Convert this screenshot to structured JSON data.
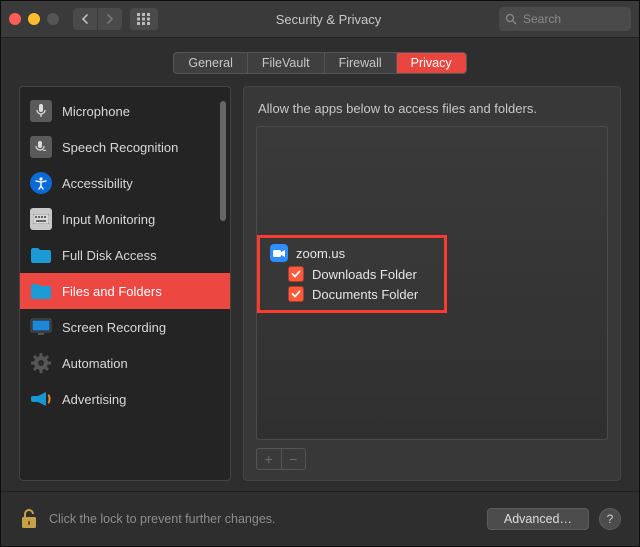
{
  "window": {
    "title": "Security & Privacy"
  },
  "search": {
    "placeholder": "Search"
  },
  "tabs": [
    {
      "label": "General",
      "active": false
    },
    {
      "label": "FileVault",
      "active": false
    },
    {
      "label": "Firewall",
      "active": false
    },
    {
      "label": "Privacy",
      "active": true
    }
  ],
  "sidebar": {
    "items": [
      {
        "label": "Microphone",
        "icon": "microphone-icon",
        "selected": false,
        "icon_bg": "#5a5a5a"
      },
      {
        "label": "Speech Recognition",
        "icon": "speech-icon",
        "selected": false,
        "icon_bg": "#5a5a5a"
      },
      {
        "label": "Accessibility",
        "icon": "accessibility-icon",
        "selected": false,
        "icon_bg": "#0a6ad6"
      },
      {
        "label": "Input Monitoring",
        "icon": "keyboard-icon",
        "selected": false,
        "icon_bg": "#c8c8c8"
      },
      {
        "label": "Full Disk Access",
        "icon": "folder-icon",
        "selected": false,
        "icon_bg": "#1a9bd6"
      },
      {
        "label": "Files and Folders",
        "icon": "folder-icon",
        "selected": true,
        "icon_bg": "#1a9bd6"
      },
      {
        "label": "Screen Recording",
        "icon": "monitor-icon",
        "selected": false,
        "icon_bg": "#1e88d8"
      },
      {
        "label": "Automation",
        "icon": "gear-icon",
        "selected": false,
        "icon_bg": "#3a3a3a"
      },
      {
        "label": "Advertising",
        "icon": "megaphone-icon",
        "selected": false,
        "icon_bg": "#1896d4"
      }
    ]
  },
  "main": {
    "allow_text": "Allow the apps below to access files and folders.",
    "app": {
      "name": "zoom.us",
      "permissions": [
        {
          "label": "Downloads Folder",
          "checked": true
        },
        {
          "label": "Documents Folder",
          "checked": true
        }
      ]
    }
  },
  "footer": {
    "lock_text": "Click the lock to prevent further changes.",
    "advanced_label": "Advanced…",
    "help_label": "?"
  },
  "colors": {
    "accent": "#e9463f",
    "highlight_border": "#ff3b30",
    "zoom_blue": "#2d8cff"
  }
}
